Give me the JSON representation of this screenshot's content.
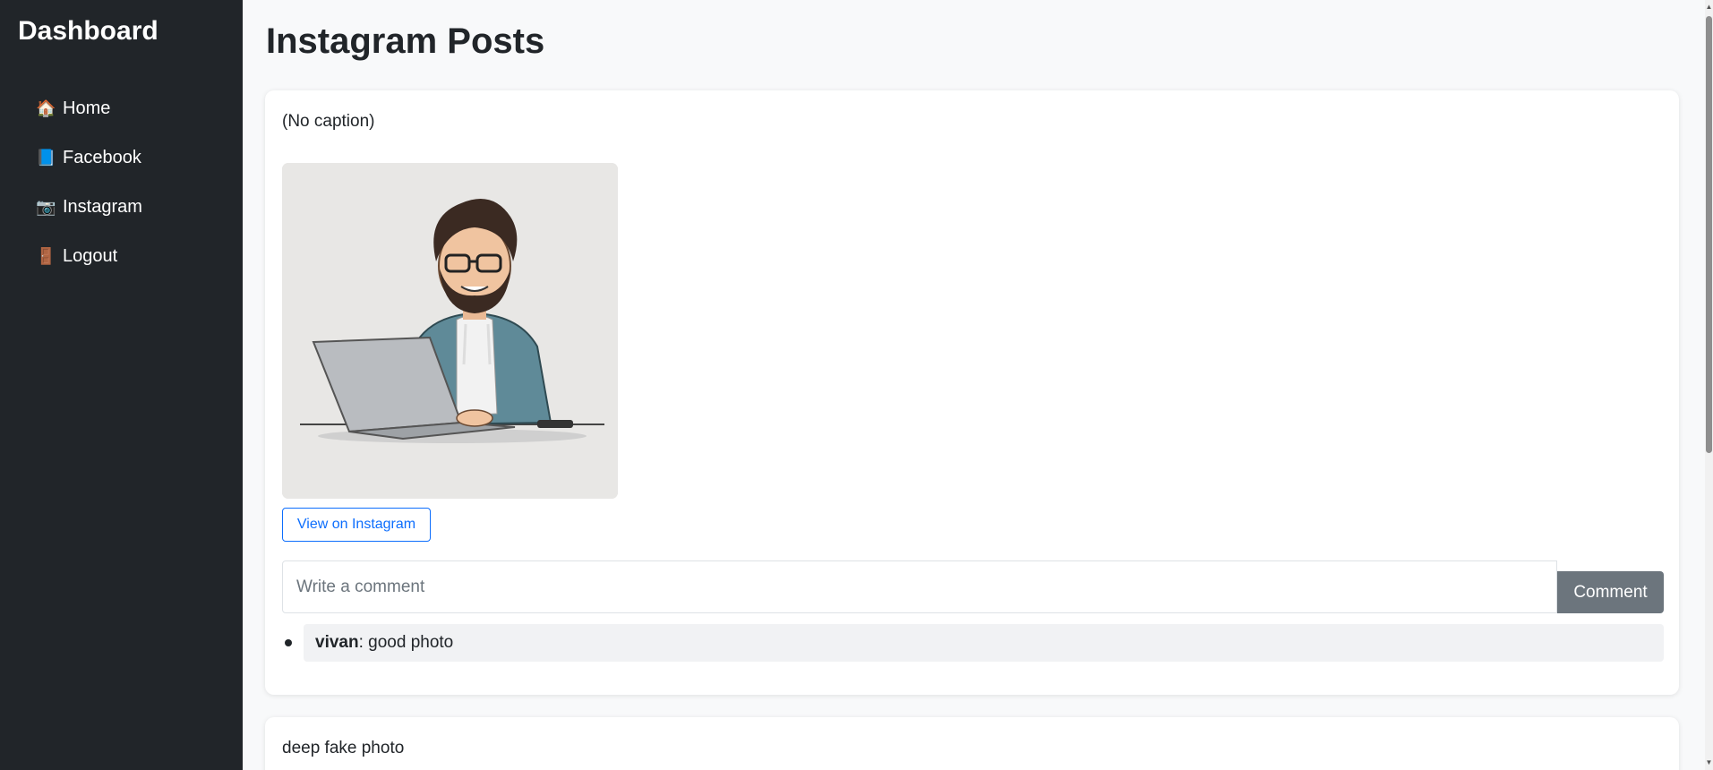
{
  "sidebar": {
    "brand": "Dashboard",
    "items": [
      {
        "icon": "🏠",
        "icon_name": "home-icon",
        "label": "Home"
      },
      {
        "icon": "📘",
        "icon_name": "facebook-book-icon",
        "label": "Facebook"
      },
      {
        "icon": "📷",
        "icon_name": "camera-icon",
        "label": "Instagram"
      },
      {
        "icon": "🚪",
        "icon_name": "door-icon",
        "label": "Logout"
      }
    ]
  },
  "main": {
    "title": "Instagram Posts",
    "posts": [
      {
        "caption": "(No caption)",
        "image_description": "illustration of bearded man with glasses using a laptop",
        "view_button_label": "View on Instagram",
        "comment_placeholder": "Write a comment",
        "comment_button_label": "Comment",
        "comments": [
          {
            "user": "vivan",
            "separator": ": ",
            "text": "good photo"
          }
        ]
      },
      {
        "caption": "deep fake photo"
      }
    ]
  },
  "colors": {
    "sidebar_bg": "#212529",
    "page_bg": "#f8f9fa",
    "primary": "#0d6efd",
    "secondary": "#6c757d"
  }
}
